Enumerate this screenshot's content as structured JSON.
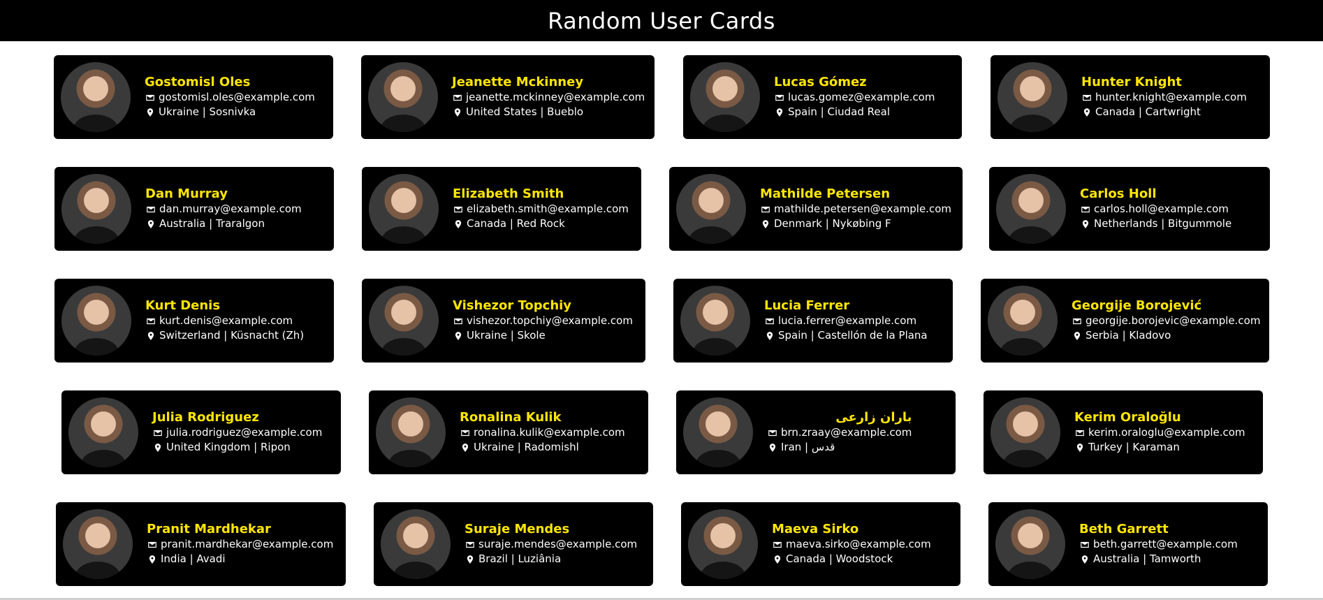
{
  "header": {
    "title": "Random User Cards"
  },
  "colors": {
    "background": "#ffffff",
    "card": "#000000",
    "name": "#ffe600",
    "text": "#ffffff"
  },
  "icons": {
    "email": "envelope-icon",
    "location": "location-pin-icon"
  },
  "cards": [
    {
      "name": "Gostomisl Oles",
      "email": "gostomisl.oles@example.com",
      "location": "Ukraine | Sosnivka"
    },
    {
      "name": "Jeanette Mckinney",
      "email": "jeanette.mckinney@example.com",
      "location": "United States | Bueblo"
    },
    {
      "name": "Lucas Gómez",
      "email": "lucas.gomez@example.com",
      "location": "Spain | Ciudad Real"
    },
    {
      "name": "Hunter Knight",
      "email": "hunter.knight@example.com",
      "location": "Canada | Cartwright"
    },
    {
      "name": "Dan Murray",
      "email": "dan.murray@example.com",
      "location": "Australia | Traralgon"
    },
    {
      "name": "Elizabeth Smith",
      "email": "elizabeth.smith@example.com",
      "location": "Canada | Red Rock"
    },
    {
      "name": "Mathilde Petersen",
      "email": "mathilde.petersen@example.com",
      "location": "Denmark | Nykøbing F"
    },
    {
      "name": "Carlos Holl",
      "email": "carlos.holl@example.com",
      "location": "Netherlands | Bitgummole"
    },
    {
      "name": "Kurt Denis",
      "email": "kurt.denis@example.com",
      "location": "Switzerland | Küsnacht (Zh)"
    },
    {
      "name": "Vishezor Topchiy",
      "email": "vishezor.topchiy@example.com",
      "location": "Ukraine | Skole"
    },
    {
      "name": "Lucia Ferrer",
      "email": "lucia.ferrer@example.com",
      "location": "Spain | Castellón de la Plana"
    },
    {
      "name": "Georgije Borojević",
      "email": "georgije.borojevic@example.com",
      "location": "Serbia | Kladovo"
    },
    {
      "name": "Julia Rodriguez",
      "email": "julia.rodriguez@example.com",
      "location": "United Kingdom | Ripon"
    },
    {
      "name": "Ronalina Kulik",
      "email": "ronalina.kulik@example.com",
      "location": "Ukraine | Radomishl"
    },
    {
      "name": "باران زارعی",
      "email": "brn.zraay@example.com",
      "location": "Iran | قدس"
    },
    {
      "name": "Kerim Oraloğlu",
      "email": "kerim.oraloglu@example.com",
      "location": "Turkey | Karaman"
    },
    {
      "name": "Pranit Mardhekar",
      "email": "pranit.mardhekar@example.com",
      "location": "India | Avadi"
    },
    {
      "name": "Suraje Mendes",
      "email": "suraje.mendes@example.com",
      "location": "Brazil | Luziânia"
    },
    {
      "name": "Maeva Sirko",
      "email": "maeva.sirko@example.com",
      "location": "Canada | Woodstock"
    },
    {
      "name": "Beth Garrett",
      "email": "beth.garrett@example.com",
      "location": "Australia | Tamworth"
    }
  ]
}
